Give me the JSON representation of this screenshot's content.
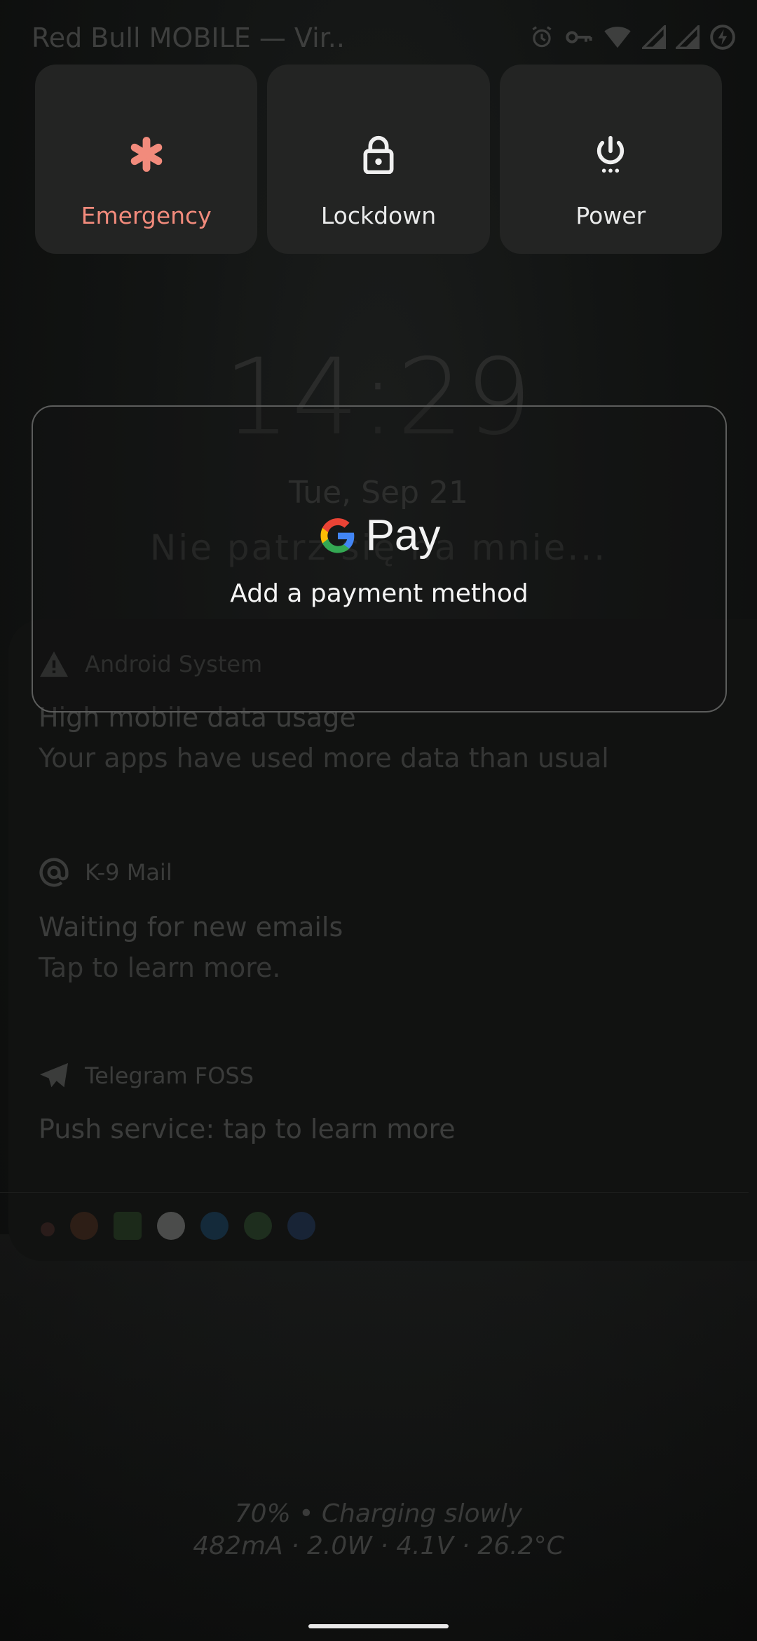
{
  "status_bar": {
    "carrier": "Red Bull MOBILE — Vir..",
    "icons": [
      "alarm-icon",
      "vpn-key-icon",
      "wifi-icon",
      "signal-icon",
      "signal-icon",
      "battery-charging-icon"
    ]
  },
  "power_menu": {
    "emergency_label": "Emergency",
    "lockdown_label": "Lockdown",
    "power_label": "Power",
    "emergency_color": "#f28b7c"
  },
  "lockscreen": {
    "time": "14:29",
    "date": "Tue, Sep 21",
    "owner_info": "Nie patrz się na mnie..."
  },
  "notifications": [
    {
      "app": "Android System",
      "title": "High mobile data usage",
      "text": "Your apps have used more data than usual"
    },
    {
      "app": "K-9 Mail",
      "title": "Waiting for new emails",
      "text": "Tap to learn more."
    },
    {
      "app": "Telegram FOSS",
      "title": "Push service: tap to learn more",
      "text": ""
    }
  ],
  "gpay": {
    "pay_text": "Pay",
    "subtitle": "Add a payment method"
  },
  "battery": {
    "line1": "70% • Charging slowly",
    "line2": "482mA · 2.0W · 4.1V · 26.2°C"
  }
}
